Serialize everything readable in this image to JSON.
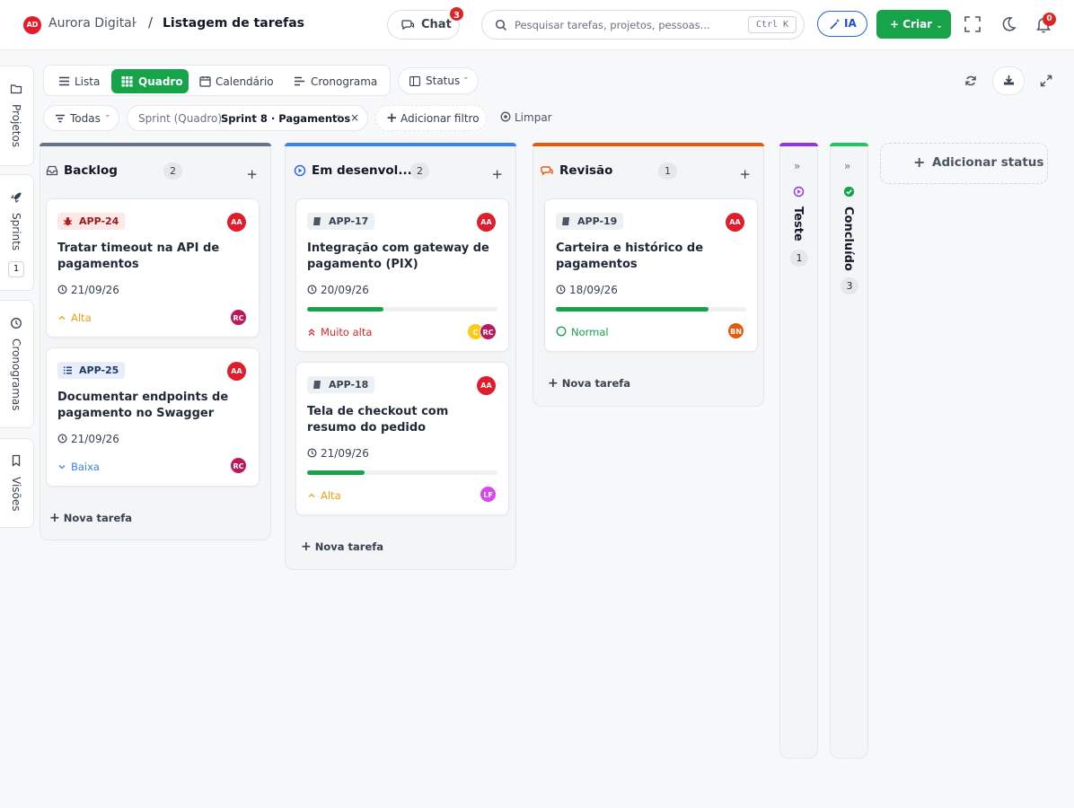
{
  "header": {
    "workspace_initials": "AD",
    "workspace_name": "Aurora Digital",
    "page_title": "Listagem de tarefas",
    "chat_label": "Chat",
    "chat_badge": "3",
    "search_placeholder": "Pesquisar tarefas, projetos, pessoas...",
    "search_shortcut": "Ctrl K",
    "ia_label": "IA",
    "create_label": "Criar",
    "notifications_count": "0"
  },
  "sidebar": {
    "items": [
      {
        "label": "Projetos",
        "icon": "folder-icon"
      },
      {
        "label": "Sprints",
        "icon": "rocket-icon",
        "count": "1"
      },
      {
        "label": "Cronogramas",
        "icon": "clock-icon"
      },
      {
        "label": "Visões",
        "icon": "bookmark-icon"
      }
    ]
  },
  "views": {
    "tabs": [
      {
        "label": "Lista",
        "icon": "list-icon",
        "active": false
      },
      {
        "label": "Quadro",
        "icon": "board-icon",
        "active": true
      },
      {
        "label": "Calendário",
        "icon": "calendar-icon",
        "active": false
      },
      {
        "label": "Cronograma",
        "icon": "timeline-icon",
        "active": false
      }
    ],
    "group_by": "Status"
  },
  "filters": {
    "scope": "Todas",
    "sprint_prefix": "Sprint (Quadro)",
    "sprint_value": "Sprint 8 · Pagamentos",
    "add_filter": "Adicionar filtro",
    "clear": "Limpar"
  },
  "colors": {
    "accent": "#16a34a",
    "backlog": "#64748b",
    "in_progress": "#3b82f6",
    "review": "#ea580c",
    "testing": "#9333ea",
    "done": "#22c55e",
    "danger": "#dc2626"
  },
  "board": {
    "columns": [
      {
        "title": "Backlog",
        "count": "2",
        "cards": [
          {
            "key": "APP-24",
            "type": "bug",
            "title": "Tratar timeout na API de pagamentos",
            "date": "21/09/26",
            "priority": "Alta",
            "owner": "AA",
            "assignees": [
              "RC"
            ]
          },
          {
            "key": "APP-25",
            "type": "task",
            "title": "Documentar endpoints de pagamento no Swagger",
            "date": "21/09/26",
            "priority": "Baixa",
            "owner": "AA",
            "assignees": [
              "RC"
            ]
          }
        ],
        "new_task": "Nova tarefa"
      },
      {
        "title": "Em desenvol...",
        "count": "2",
        "cards": [
          {
            "key": "APP-17",
            "type": "story",
            "title": "Integração com gateway de pagamento (PIX)",
            "date": "20/09/26",
            "progress": 0.4,
            "priority": "Muito alta",
            "owner": "AA",
            "assignees": [
              "C",
              "RC"
            ]
          },
          {
            "key": "APP-18",
            "type": "story",
            "title": "Tela de checkout com resumo do pedido",
            "date": "21/09/26",
            "progress": 0.3,
            "priority": "Alta",
            "owner": "AA",
            "assignees": [
              "LF"
            ]
          }
        ],
        "new_task": "Nova tarefa"
      },
      {
        "title": "Revisão",
        "count": "1",
        "cards": [
          {
            "key": "APP-19",
            "type": "story",
            "title": "Carteira e histórico de pagamentos",
            "date": "18/09/26",
            "progress": 0.8,
            "priority": "Normal",
            "owner": "AA",
            "assignees": [
              "BN"
            ]
          }
        ],
        "new_task": "Nova tarefa"
      }
    ],
    "collapsed": [
      {
        "title": "Teste",
        "count": "1"
      },
      {
        "title": "Concluído",
        "count": "3"
      }
    ],
    "add_status": "Adicionar status"
  }
}
